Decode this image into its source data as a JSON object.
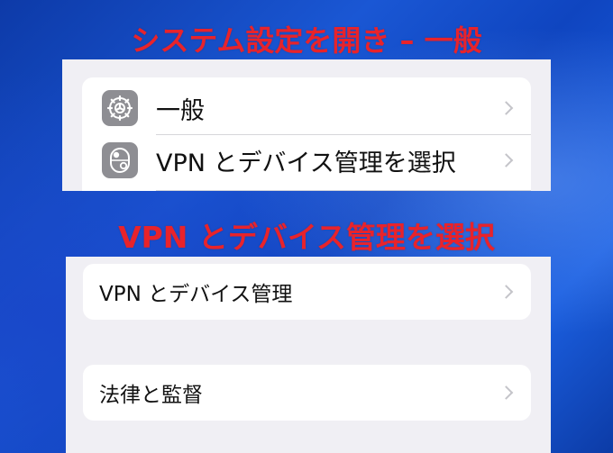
{
  "captions": {
    "step1": "システム設定を開き – 一般",
    "step2": "VPN とデバイス管理を選択"
  },
  "settings_list": {
    "general_label": "一般",
    "vpn_label": "VPN とデバイス管理を選択"
  },
  "detail_list": {
    "vpn_device_management_label": "VPN とデバイス管理",
    "legal_regulatory_label": "法律と監督"
  },
  "colors": {
    "caption": "#e8232b",
    "icon_background": "#8e8e93",
    "chevron": "#c4c4c9"
  },
  "icons": {
    "general": "gear-icon",
    "vpn": "toggle-icon",
    "chevron": "chevron-right-icon"
  }
}
